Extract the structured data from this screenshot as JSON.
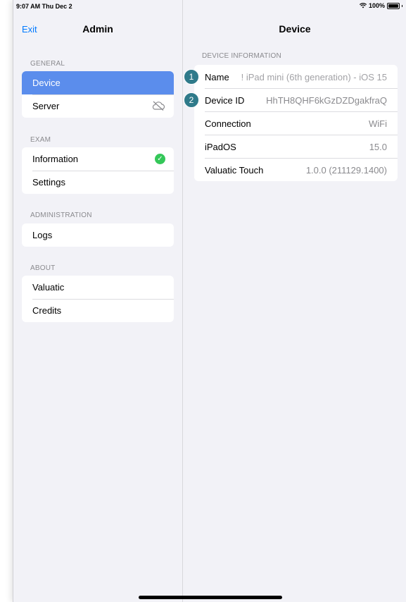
{
  "status": {
    "time": "9:07 AM  Thu Dec 2",
    "battery": "100%",
    "battery_level": 1.0
  },
  "sidebar": {
    "back_label": "Exit",
    "title": "Admin",
    "sections": [
      {
        "header": "GENERAL",
        "items": [
          {
            "label": "Device",
            "selected": true
          },
          {
            "label": "Server",
            "accessory": "cloud-offline-icon"
          }
        ]
      },
      {
        "header": "EXAM",
        "items": [
          {
            "label": "Information",
            "accessory": "checkmark-circle-icon"
          },
          {
            "label": "Settings"
          }
        ]
      },
      {
        "header": "ADMINISTRATION",
        "items": [
          {
            "label": "Logs"
          }
        ]
      },
      {
        "header": "ABOUT",
        "items": [
          {
            "label": "Valuatic"
          },
          {
            "label": "Credits"
          }
        ]
      }
    ]
  },
  "detail": {
    "title": "Device",
    "section_header": "DEVICE INFORMATION",
    "rows": [
      {
        "badge": "1",
        "label": "Name",
        "value": "! iPad mini (6th generation) - iOS 15"
      },
      {
        "badge": "2",
        "label": "Device ID",
        "value": "HhTH8QHF6kGzDZDgakfraQ"
      },
      {
        "label": "Connection",
        "value": "WiFi"
      },
      {
        "label": "iPadOS",
        "value": "15.0"
      },
      {
        "label": "Valuatic Touch",
        "value": "1.0.0 (211129.1400)"
      }
    ]
  },
  "colors": {
    "accent": "#007aff",
    "selected": "#5b8dec",
    "success": "#34c759",
    "badge": "#2f7a8a"
  }
}
